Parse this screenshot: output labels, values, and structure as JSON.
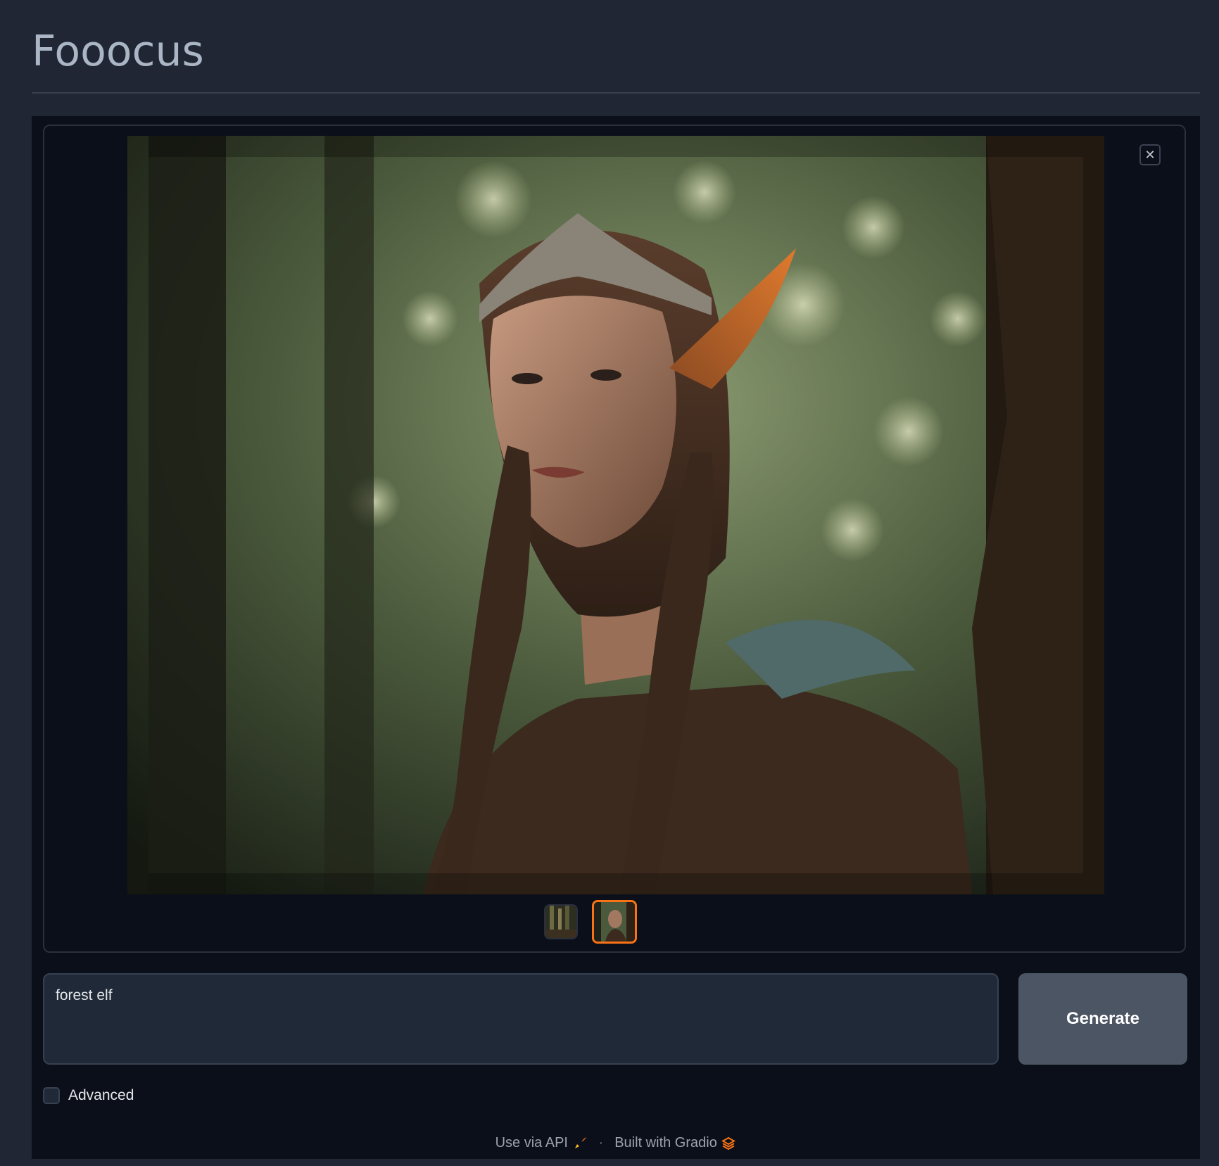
{
  "app": {
    "title": "Fooocus"
  },
  "gallery": {
    "close_label": "✕",
    "thumbnail_count": 2,
    "selected_index": 1
  },
  "prompt": {
    "value": "forest elf"
  },
  "generate": {
    "label": "Generate"
  },
  "advanced": {
    "label": "Advanced",
    "checked": false
  },
  "footer": {
    "api_label": "Use via API",
    "separator": "·",
    "gradio_label": "Built with Gradio"
  },
  "colors": {
    "accent": "#f97316",
    "background": "#0b0f19",
    "header_background": "#202633",
    "button": "#4b5563"
  },
  "icons": {
    "close": "close-icon",
    "api": "rocket-icon",
    "gradio": "gradio-logo-icon"
  }
}
